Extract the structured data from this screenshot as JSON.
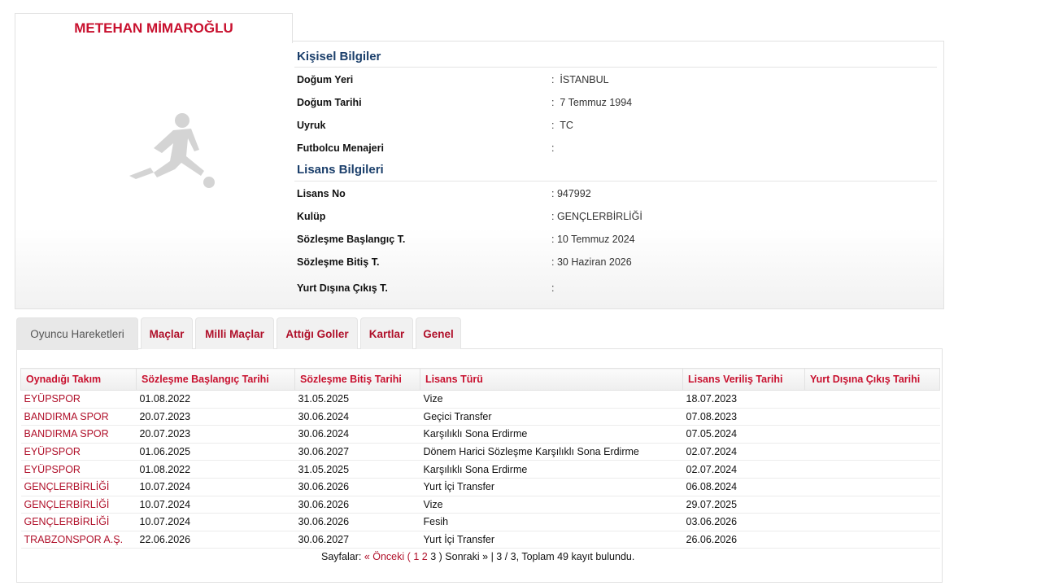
{
  "profile": {
    "name": "METEHAN MİMAROĞLU"
  },
  "personal": {
    "title": "Kişisel Bilgiler",
    "rows": [
      {
        "label": "Doğum Yeri",
        "value": ":  İSTANBUL"
      },
      {
        "label": "Doğum Tarihi",
        "value": ":  7 Temmuz 1994"
      },
      {
        "label": "Uyruk",
        "value": ":  TC"
      },
      {
        "label": "Futbolcu Menajeri",
        "value": ":"
      }
    ]
  },
  "license": {
    "title": "Lisans Bilgileri",
    "rows": [
      {
        "label": "Lisans No",
        "value": ": 947992"
      },
      {
        "label": "Kulüp",
        "value": ": GENÇLERBİRLİĞİ"
      },
      {
        "label": "Sözleşme Başlangıç T.",
        "value": ": 10 Temmuz 2024"
      },
      {
        "label": "Sözleşme Bitiş T.",
        "value": ": 30 Haziran 2026"
      },
      {
        "label": "Yurt Dışına Çıkış T.",
        "value": ":"
      }
    ]
  },
  "tabs": [
    {
      "label": "Oyuncu Hareketleri",
      "active": true
    },
    {
      "label": "Maçlar",
      "active": false
    },
    {
      "label": "Milli Maçlar",
      "active": false
    },
    {
      "label": "Attığı Goller",
      "active": false
    },
    {
      "label": "Kartlar",
      "active": false
    },
    {
      "label": "Genel",
      "active": false
    }
  ],
  "table": {
    "headers": [
      "Oynadığı Takım",
      "Sözleşme Başlangıç Tarihi",
      "Sözleşme Bitiş Tarihi",
      "Lisans Türü",
      "Lisans Veriliş Tarihi",
      "Yurt Dışına Çıkış Tarihi"
    ],
    "rows": [
      [
        "EYÜPSPOR",
        "01.08.2022",
        "31.05.2025",
        "Vize",
        "18.07.2023",
        ""
      ],
      [
        "BANDIRMA SPOR",
        "20.07.2023",
        "30.06.2024",
        "Geçici Transfer",
        "07.08.2023",
        ""
      ],
      [
        "BANDIRMA SPOR",
        "20.07.2023",
        "30.06.2024",
        "Karşılıklı Sona Erdirme",
        "07.05.2024",
        ""
      ],
      [
        "EYÜPSPOR",
        "01.06.2025",
        "30.06.2027",
        "Dönem Harici Sözleşme Karşılıklı Sona Erdirme",
        "02.07.2024",
        ""
      ],
      [
        "EYÜPSPOR",
        "01.08.2022",
        "31.05.2025",
        "Karşılıklı Sona Erdirme",
        "02.07.2024",
        ""
      ],
      [
        "GENÇLERBİRLİĞİ",
        "10.07.2024",
        "30.06.2026",
        "Yurt İçi Transfer",
        "06.08.2024",
        ""
      ],
      [
        "GENÇLERBİRLİĞİ",
        "10.07.2024",
        "30.06.2026",
        "Vize",
        "29.07.2025",
        ""
      ],
      [
        "GENÇLERBİRLİĞİ",
        "10.07.2024",
        "30.06.2026",
        "Fesih",
        "03.06.2026",
        ""
      ],
      [
        "TRABZONSPOR A.Ş.",
        "22.06.2026",
        "30.06.2027",
        "Yurt İçi Transfer",
        "26.06.2026",
        ""
      ]
    ]
  },
  "pager": {
    "prefix": "Sayfalar:",
    "prev": "« Önceki",
    "open_paren": "(",
    "pages": [
      "1",
      "2"
    ],
    "current": "3",
    "close_paren": ")",
    "next": "Sonraki »",
    "summary": "| 3 / 3, Toplam 49 kayıt bulundu."
  },
  "colors": {
    "accent": "#c8102e",
    "section_title": "#1b3f6b"
  }
}
